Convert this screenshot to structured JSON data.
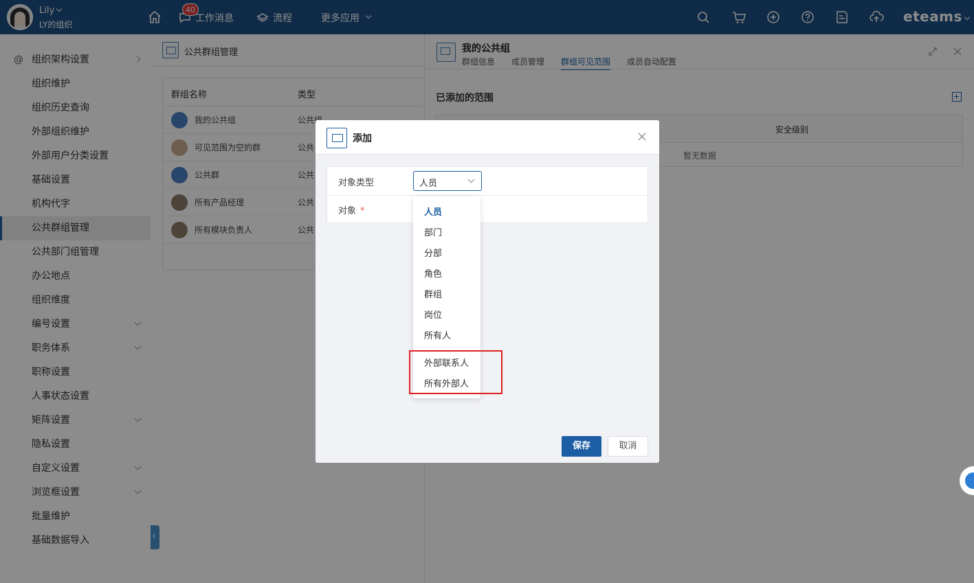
{
  "header": {
    "user_name": "Lily",
    "user_org": "LY的组织",
    "nav": [
      {
        "label": "工作消息",
        "badge": "40"
      },
      {
        "label": "流程"
      },
      {
        "label": "更多应用"
      }
    ],
    "brand": "eteams"
  },
  "sidebar": {
    "items": [
      {
        "label": "组织架构设置",
        "expand": "right"
      },
      {
        "label": "组织维护"
      },
      {
        "label": "组织历史查询"
      },
      {
        "label": "外部组织维护"
      },
      {
        "label": "外部用户分类设置"
      },
      {
        "label": "基础设置"
      },
      {
        "label": "机构代字"
      },
      {
        "label": "公共群组管理",
        "active": true
      },
      {
        "label": "公共部门组管理"
      },
      {
        "label": "办公地点"
      },
      {
        "label": "组织维度"
      },
      {
        "label": "编号设置",
        "expand": "down"
      },
      {
        "label": "职务体系",
        "expand": "down"
      },
      {
        "label": "职称设置"
      },
      {
        "label": "人事状态设置"
      },
      {
        "label": "矩阵设置",
        "expand": "down"
      },
      {
        "label": "隐私设置"
      },
      {
        "label": "自定义设置",
        "expand": "down"
      },
      {
        "label": "浏览框设置",
        "expand": "down"
      },
      {
        "label": "批量维护"
      },
      {
        "label": "基础数据导入"
      }
    ]
  },
  "list_panel": {
    "title": "公共群组管理",
    "columns": [
      "群组名称",
      "类型"
    ],
    "rows": [
      {
        "name": "我的公共组",
        "type": "公共组"
      },
      {
        "name": "可见范围为空的群",
        "type": "公共"
      },
      {
        "name": "公共群",
        "type": "公共"
      },
      {
        "name": "所有产品经理",
        "type": "公共"
      },
      {
        "name": "所有模块负责人",
        "type": "公共"
      }
    ]
  },
  "detail": {
    "title": "我的公共组",
    "tabs": [
      "群组信息",
      "成员管理",
      "群组可见范围",
      "成员自动配置"
    ],
    "active_tab": "群组可见范围",
    "section_title": "已添加的范围",
    "table_col": "安全级别",
    "empty_text": "暂无数据"
  },
  "modal": {
    "title": "添加",
    "field_type_label": "对象类型",
    "field_type_value": "人员",
    "field_object_label": "对象",
    "required_mark": "*",
    "options": [
      "人员",
      "部门",
      "分部",
      "角色",
      "群组",
      "岗位",
      "所有人",
      "外部联系人",
      "所有外部人"
    ],
    "save": "保存",
    "cancel": "取消"
  },
  "colors": {
    "topbar": "#1c4f82",
    "accent": "#1c5ea3",
    "highlight": "#e02020"
  }
}
